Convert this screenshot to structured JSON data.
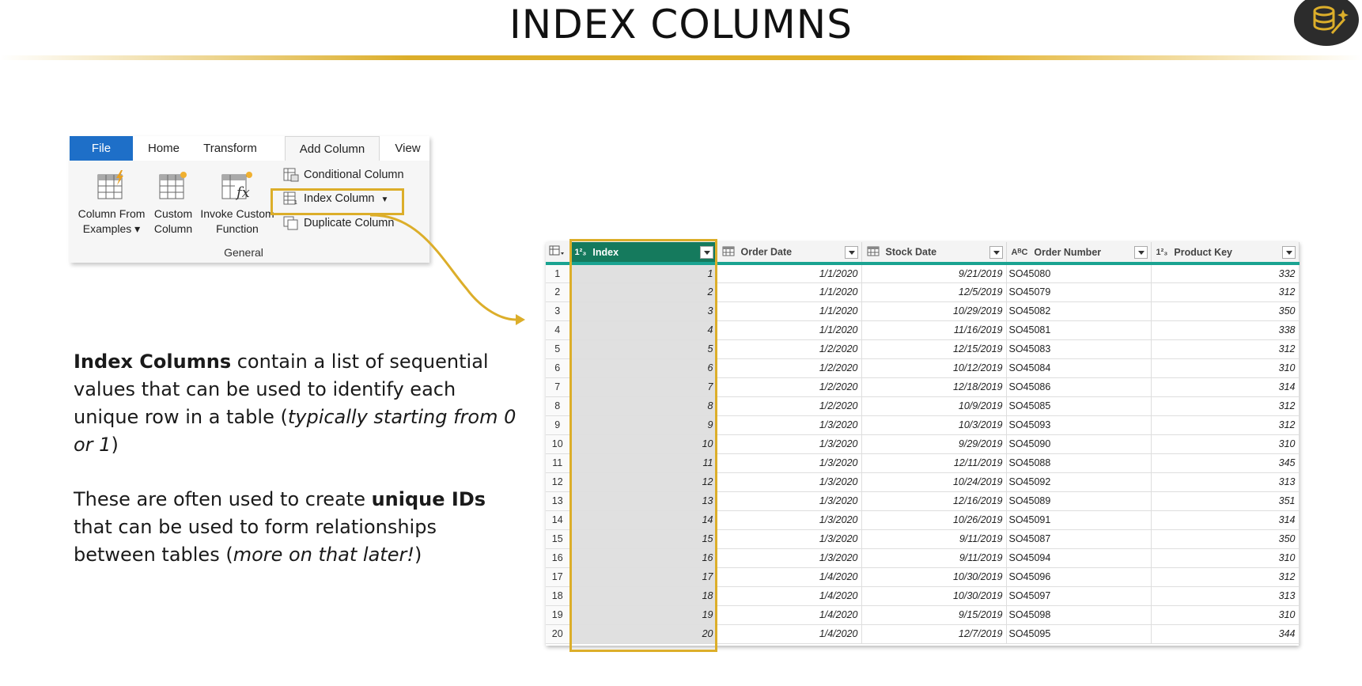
{
  "slide": {
    "title": "INDEX COLUMNS"
  },
  "ribbon": {
    "tabs": [
      "File",
      "Home",
      "Transform",
      "Add Column",
      "View"
    ],
    "buttons": {
      "column_from_examples": [
        "Column From",
        "Examples"
      ],
      "custom_column": [
        "Custom",
        "Column"
      ],
      "invoke_custom_function": [
        "Invoke Custom",
        "Function"
      ]
    },
    "small_items": {
      "conditional_column": "Conditional Column",
      "index_column": "Index Column",
      "duplicate_column": "Duplicate Column"
    },
    "group_label": "General"
  },
  "description": {
    "p1": {
      "bold": "Index Columns",
      "text1": " contain a list of sequential values that can be used to identify each unique row in a table (",
      "italic": "typically starting from 0 or 1",
      "text2": ")"
    },
    "p2": {
      "text1": "These are often used to create ",
      "bold": "unique IDs",
      "text2": " that can be used to form relationships between tables (",
      "italic": "more on that later!",
      "text3": ")"
    }
  },
  "table": {
    "columns": [
      {
        "name": "Index",
        "type_icon": "1²₃"
      },
      {
        "name": "Order Date",
        "type_icon": "calendar"
      },
      {
        "name": "Stock Date",
        "type_icon": "calendar"
      },
      {
        "name": "Order Number",
        "type_icon": "AᴮC"
      },
      {
        "name": "Product Key",
        "type_icon": "1²₃"
      }
    ],
    "rows": [
      [
        "1",
        "1",
        "1/1/2020",
        "9/21/2019",
        "SO45080",
        "332"
      ],
      [
        "2",
        "2",
        "1/1/2020",
        "12/5/2019",
        "SO45079",
        "312"
      ],
      [
        "3",
        "3",
        "1/1/2020",
        "10/29/2019",
        "SO45082",
        "350"
      ],
      [
        "4",
        "4",
        "1/1/2020",
        "11/16/2019",
        "SO45081",
        "338"
      ],
      [
        "5",
        "5",
        "1/2/2020",
        "12/15/2019",
        "SO45083",
        "312"
      ],
      [
        "6",
        "6",
        "1/2/2020",
        "10/12/2019",
        "SO45084",
        "310"
      ],
      [
        "7",
        "7",
        "1/2/2020",
        "12/18/2019",
        "SO45086",
        "314"
      ],
      [
        "8",
        "8",
        "1/2/2020",
        "10/9/2019",
        "SO45085",
        "312"
      ],
      [
        "9",
        "9",
        "1/3/2020",
        "10/3/2019",
        "SO45093",
        "312"
      ],
      [
        "10",
        "10",
        "1/3/2020",
        "9/29/2019",
        "SO45090",
        "310"
      ],
      [
        "11",
        "11",
        "1/3/2020",
        "12/11/2019",
        "SO45088",
        "345"
      ],
      [
        "12",
        "12",
        "1/3/2020",
        "10/24/2019",
        "SO45092",
        "313"
      ],
      [
        "13",
        "13",
        "1/3/2020",
        "12/16/2019",
        "SO45089",
        "351"
      ],
      [
        "14",
        "14",
        "1/3/2020",
        "10/26/2019",
        "SO45091",
        "314"
      ],
      [
        "15",
        "15",
        "1/3/2020",
        "9/11/2019",
        "SO45087",
        "350"
      ],
      [
        "16",
        "16",
        "1/3/2020",
        "9/11/2019",
        "SO45094",
        "310"
      ],
      [
        "17",
        "17",
        "1/4/2020",
        "10/30/2019",
        "SO45096",
        "312"
      ],
      [
        "18",
        "18",
        "1/4/2020",
        "10/30/2019",
        "SO45097",
        "313"
      ],
      [
        "19",
        "19",
        "1/4/2020",
        "9/15/2019",
        "SO45098",
        "310"
      ],
      [
        "20",
        "20",
        "1/4/2020",
        "12/7/2019",
        "SO45095",
        "344"
      ]
    ]
  },
  "colors": {
    "accent_gold": "#dcae2a",
    "file_tab": "#1e6fc8",
    "index_header": "#157a5d",
    "header_underline": "#1aa391"
  },
  "icons": {
    "logo": "database-wand-icon",
    "table": "table-menu-icon",
    "column_from_examples": "column-from-examples-icon",
    "custom_column": "custom-column-icon",
    "invoke_function": "function-fx-icon",
    "conditional": "conditional-column-icon",
    "index": "index-column-icon",
    "duplicate": "duplicate-column-icon"
  }
}
